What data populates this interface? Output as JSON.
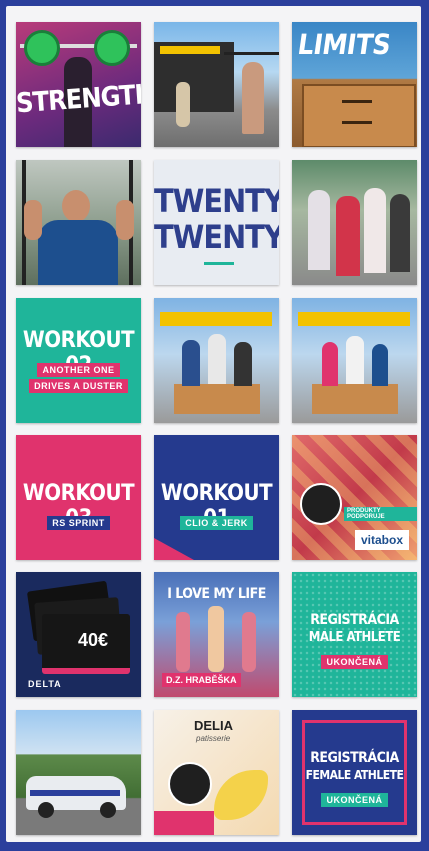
{
  "tiles": {
    "strength": {
      "text": "STRENGTH"
    },
    "limits": {
      "text": "LIMITS"
    },
    "twenty": {
      "line1": "TWENTY",
      "line2": "TWENTY"
    },
    "workout02": {
      "title": "WORKOUT 02",
      "line1": "ANOTHER ONE",
      "line2": "DRIVES A DUSTER"
    },
    "workout03": {
      "title": "WORKOUT 03",
      "sub": "RS SPRINT"
    },
    "workout01": {
      "title": "WORKOUT 01",
      "sub": "CLIO & JERK"
    },
    "vitabox": {
      "badge": "vitabox",
      "promo": "PRODUKTY PODPORUJE"
    },
    "voucher": {
      "price": "40€",
      "brand": "DELTA"
    },
    "lovelife": {
      "text": "I LOVE MY LIFE",
      "caption": "D.Z. HRABĚŠKA"
    },
    "reg_male": {
      "line1": "REGISTRÁCIA",
      "line2": "MALE ATHLETE",
      "badge": "UKONČENÁ"
    },
    "delia": {
      "brand": "DELIA",
      "sub": "patisserie"
    },
    "reg_female": {
      "line1": "REGISTRÁCIA",
      "line2": "FEMALE ATHLETE",
      "badge": "UKONČENÁ"
    }
  },
  "colors": {
    "frame": "#2b3f9c",
    "teal": "#1fb59a",
    "pink": "#e0336d",
    "navy": "#253a8e"
  }
}
